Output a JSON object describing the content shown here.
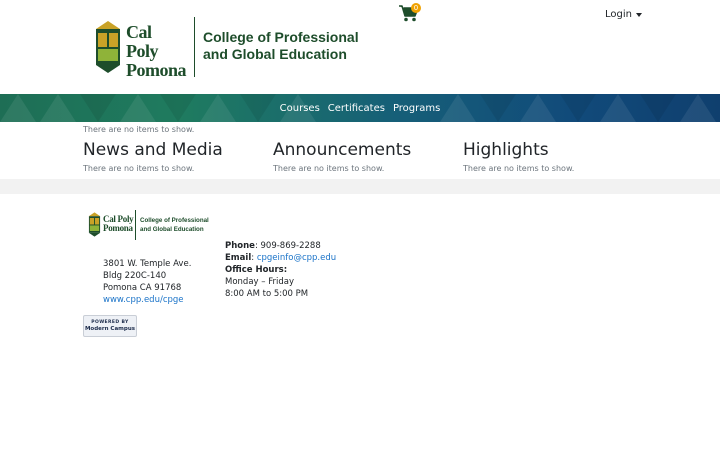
{
  "header": {
    "logo": {
      "word1": "Cal Poly",
      "word2": "Pomona",
      "college_line1": "College of Professional",
      "college_line2": "and Global Education"
    },
    "cart": {
      "count": "0",
      "icon": "cart-icon"
    },
    "login_label": "Login"
  },
  "nav": {
    "items": [
      {
        "label": "Courses"
      },
      {
        "label": "Certificates"
      },
      {
        "label": "Programs"
      }
    ]
  },
  "main": {
    "empty_message": "There are no items to show.",
    "sections": [
      {
        "title": "News and Media",
        "empty": "There are no items to show."
      },
      {
        "title": "Announcements",
        "empty": "There are no items to show."
      },
      {
        "title": "Highlights",
        "empty": "There are no items to show."
      }
    ]
  },
  "footer": {
    "logo": {
      "word1": "Cal Poly",
      "word2": "Pomona",
      "college_line1": "College of Professional",
      "college_line2": "and Global Education"
    },
    "address": {
      "line1": "3801 W. Temple Ave.",
      "line2": "Bldg 220C-140",
      "line3": "Pomona CA 91768",
      "website": "www.cpp.edu/cpge"
    },
    "contact": {
      "phone_label": "Phone",
      "phone": "909-869-2288",
      "email_label": "Email",
      "email": "cpgeinfo@cpp.edu",
      "hours_label": "Office Hours:",
      "days": "Monday – Friday",
      "hours": "8:00 AM to 5:00 PM"
    },
    "powered": {
      "line1": "POWERED BY",
      "line2": "Modern Campus"
    }
  },
  "colors": {
    "brand_green": "#1e4d2b",
    "accent_gold": "#f0a202",
    "link_blue": "#1a73c8"
  }
}
